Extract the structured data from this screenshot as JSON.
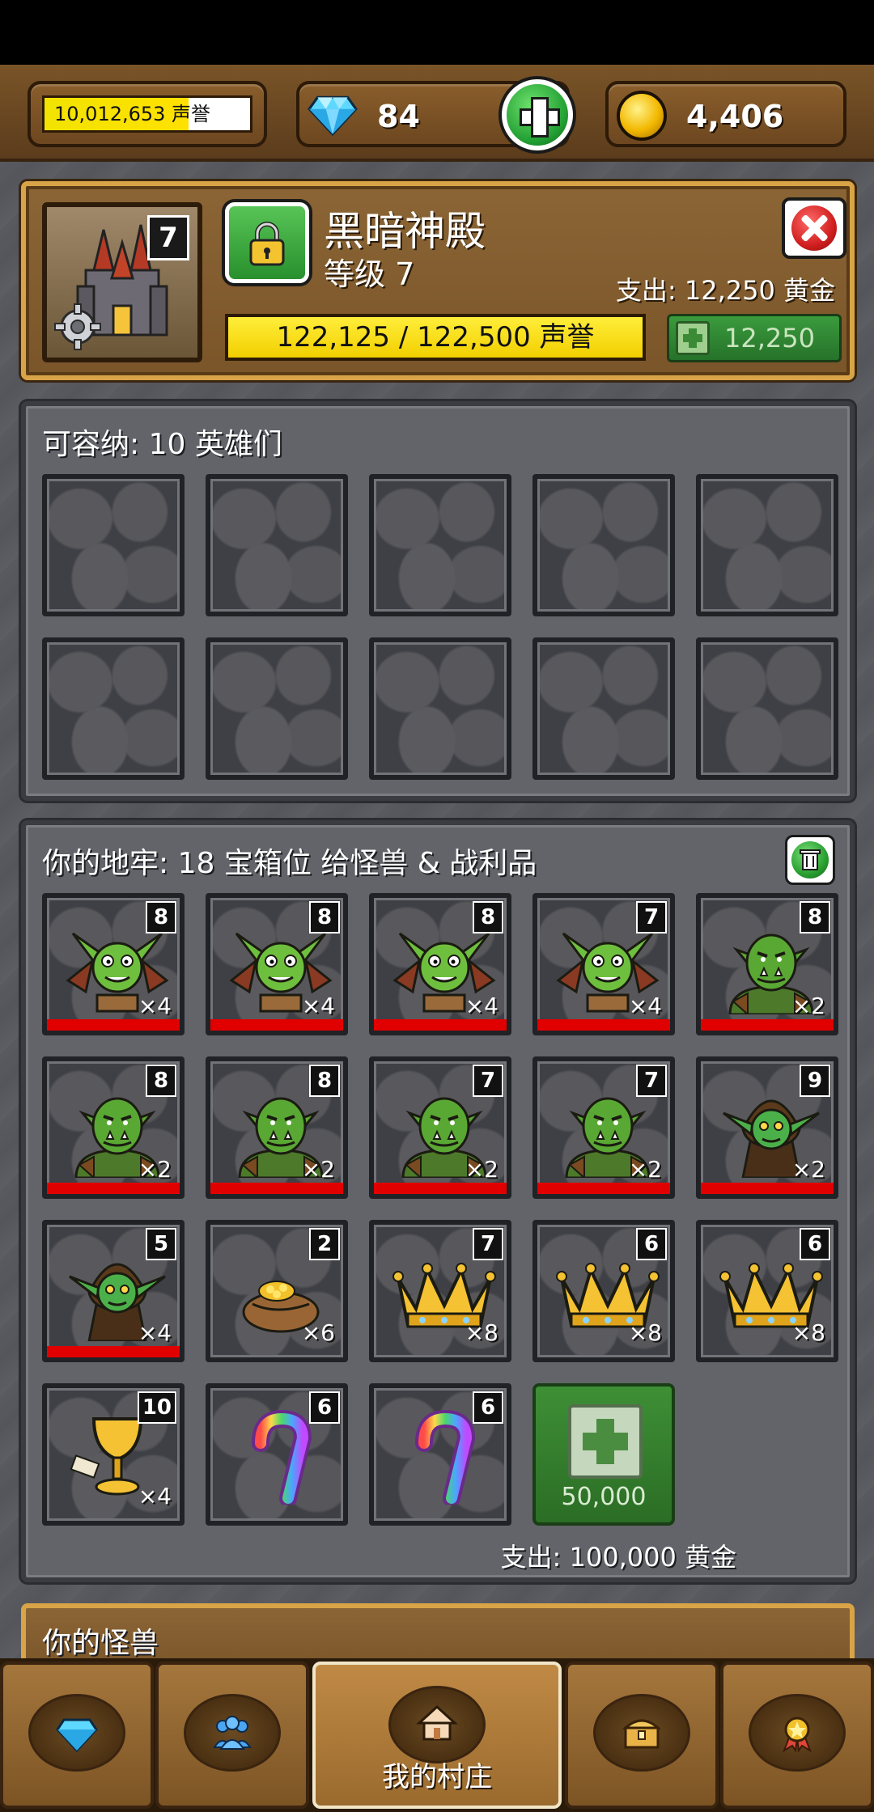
{
  "topbar": {
    "reputation": "10,012,653 声誉",
    "gems": "84",
    "gold": "4,406"
  },
  "building": {
    "level_badge": "7",
    "name": "黑暗神殿",
    "level_text": "等级 7",
    "cost": "支出: 12,250 黄金",
    "reputation_progress": "122,125 / 122,500 声誉",
    "reputation_fraction": 0.997,
    "upgrade_price": "12,250"
  },
  "heroes_panel": {
    "title": "可容纳: 10 英雄们",
    "slot_count": 10
  },
  "dungeon_panel": {
    "title": "你的地牢: 18 宝箱位 给怪兽 & 战利品",
    "items": [
      {
        "type": "bat-goblin",
        "level": "8",
        "count": "×4",
        "red": true
      },
      {
        "type": "bat-goblin",
        "level": "8",
        "count": "×4",
        "red": true
      },
      {
        "type": "bat-goblin",
        "level": "8",
        "count": "×4",
        "red": true
      },
      {
        "type": "bat-goblin",
        "level": "7",
        "count": "×4",
        "red": true
      },
      {
        "type": "orc",
        "level": "8",
        "count": "×2",
        "red": true
      },
      {
        "type": "orc",
        "level": "8",
        "count": "×2",
        "red": true
      },
      {
        "type": "orc",
        "level": "8",
        "count": "×2",
        "red": true
      },
      {
        "type": "orc",
        "level": "7",
        "count": "×2",
        "red": true
      },
      {
        "type": "orc",
        "level": "7",
        "count": "×2",
        "red": true
      },
      {
        "type": "hooded-goblin",
        "level": "9",
        "count": "×2",
        "red": true
      },
      {
        "type": "hooded-goblin",
        "level": "5",
        "count": "×4",
        "red": true
      },
      {
        "type": "gold-sack",
        "level": "2",
        "count": "×6",
        "red": false
      },
      {
        "type": "crown",
        "level": "7",
        "count": "×8",
        "red": false
      },
      {
        "type": "crown",
        "level": "6",
        "count": "×8",
        "red": false
      },
      {
        "type": "crown",
        "level": "6",
        "count": "×8",
        "red": false
      },
      {
        "type": "chalice",
        "level": "10",
        "count": "×4",
        "red": false
      },
      {
        "type": "candy-cane",
        "level": "6",
        "count": "",
        "red": false
      },
      {
        "type": "candy-cane",
        "level": "6",
        "count": "",
        "red": false
      }
    ],
    "buy_slot_price": "50,000",
    "cost": "支出: 100,000 黄金"
  },
  "monsters_panel": {
    "title": "你的怪兽"
  },
  "nav": {
    "village_label": "我的村庄"
  },
  "colors": {
    "wood": "#7a5529",
    "gold_trim": "#d9a447",
    "stone": "#62646a",
    "reputation_yellow": "#f2e300",
    "health_red": "#e00000",
    "button_green": "#2b6d25"
  }
}
